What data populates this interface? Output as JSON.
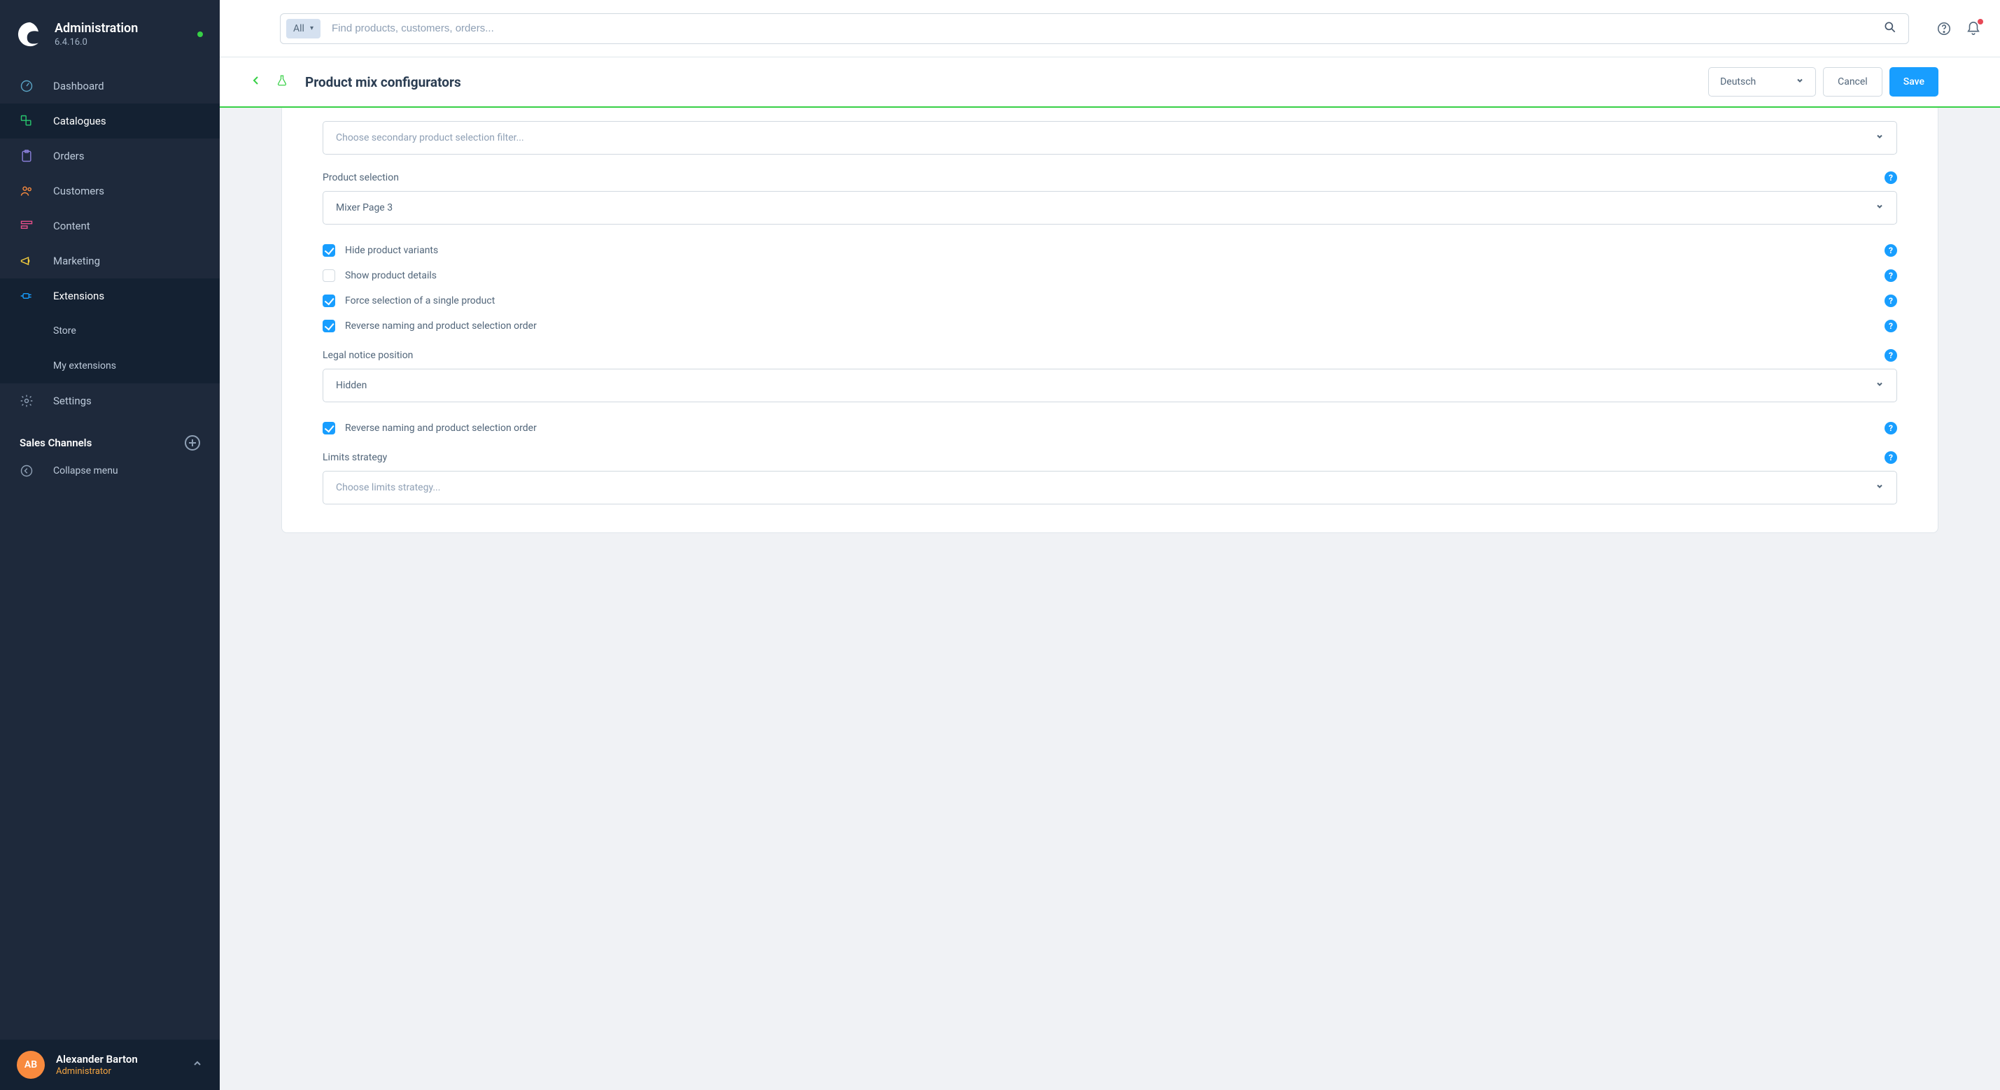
{
  "app": {
    "title": "Administration",
    "version": "6.4.16.0"
  },
  "nav": {
    "dashboard": "Dashboard",
    "catalogues": "Catalogues",
    "orders": "Orders",
    "customers": "Customers",
    "content": "Content",
    "marketing": "Marketing",
    "extensions": "Extensions",
    "store": "Store",
    "my_extensions": "My extensions",
    "settings": "Settings",
    "sales_channels": "Sales Channels",
    "collapse": "Collapse menu"
  },
  "user": {
    "initials": "AB",
    "name": "Alexander Barton",
    "role": "Administrator"
  },
  "search": {
    "scope": "All",
    "placeholder": "Find products, customers, orders..."
  },
  "page": {
    "title": "Product mix configurators",
    "language": "Deutsch",
    "cancel": "Cancel",
    "save": "Save"
  },
  "form": {
    "secondary_filter_placeholder": "Choose secondary product selection filter...",
    "product_selection_label": "Product selection",
    "product_selection_value": "Mixer Page 3",
    "hide_variants": "Hide product variants",
    "show_details": "Show product details",
    "force_single": "Force selection of a single product",
    "reverse_naming": "Reverse naming and product selection order",
    "legal_notice_label": "Legal notice position",
    "legal_notice_value": "Hidden",
    "reverse_naming2": "Reverse naming and product selection order",
    "limits_label": "Limits strategy",
    "limits_placeholder": "Choose limits strategy..."
  }
}
